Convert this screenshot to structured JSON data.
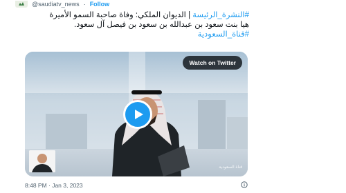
{
  "header": {
    "handle": "@saudiatv_news",
    "separator": "·",
    "follow_label": "Follow"
  },
  "tweet": {
    "hashtag1": "#النشرة_الرئيسة",
    "text_line1_rest": " | الديوان الملكي: وفاة صاحبة السمو الأميرة",
    "text_line2": "هيا بنت سعود بن عبدالله بن سعود بن فيصل آل سعود.",
    "hashtag2": "#قناة_السعودية"
  },
  "media": {
    "watch_label": "Watch on Twitter",
    "channel_mark": "قناة السعودية"
  },
  "footer": {
    "timestamp": "8:48 PM · Jan 3, 2023"
  },
  "colors": {
    "accent": "#1d9bf0",
    "text": "#0f1419",
    "muted": "#536471"
  }
}
